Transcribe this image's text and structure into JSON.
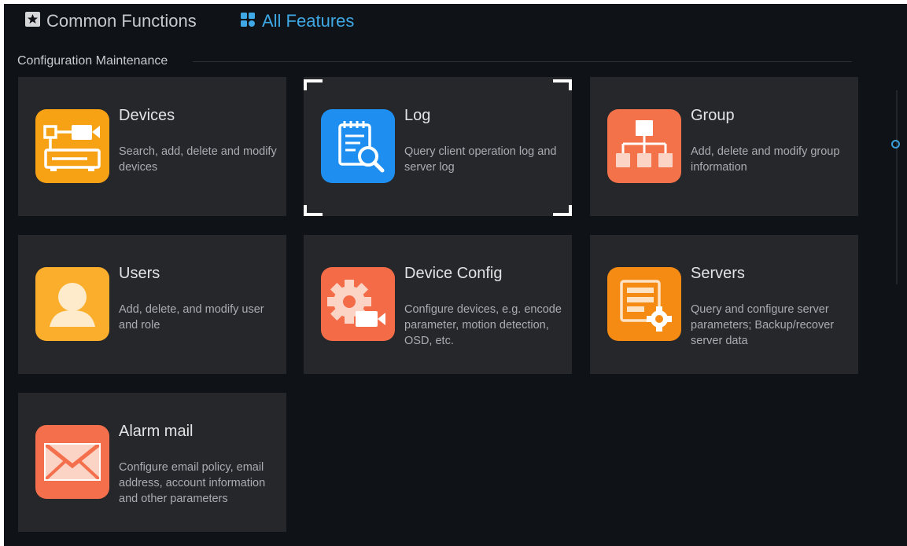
{
  "tabs": {
    "common": {
      "label": "Common Functions",
      "icon": "star-icon"
    },
    "all": {
      "label": "All Features",
      "icon": "grid-icon",
      "active": true
    }
  },
  "section": {
    "title": "Configuration Maintenance"
  },
  "cards": [
    {
      "title": "Devices",
      "description": "Search, add, delete and modify devices",
      "icon": "devices-icon",
      "color": "#f7a214"
    },
    {
      "title": "Log",
      "description": "Query client operation log and server log",
      "icon": "log-icon",
      "color": "#1e8ff0",
      "focused": true
    },
    {
      "title": "Group",
      "description": "Add, delete and modify group information",
      "icon": "group-icon",
      "color": "#f47249"
    },
    {
      "title": "Users",
      "description": "Add, delete, and modify user and role",
      "icon": "user-icon",
      "color": "#fbae2c"
    },
    {
      "title": "Device Config",
      "description": "Configure devices, e.g. encode parameter, motion detection, OSD, etc.",
      "icon": "device-config-icon",
      "color": "#f46b48"
    },
    {
      "title": "Servers",
      "description": "Query and configure server parameters; Backup/recover server data",
      "icon": "servers-icon",
      "color": "#f58b13"
    },
    {
      "title": "Alarm mail",
      "description": "Configure email policy, email address, account information and other parameters",
      "icon": "mail-icon",
      "color": "#f4704c"
    }
  ],
  "colors": {
    "background": "#0f1318",
    "card": "#25272b",
    "accent": "#3fa9e6"
  }
}
